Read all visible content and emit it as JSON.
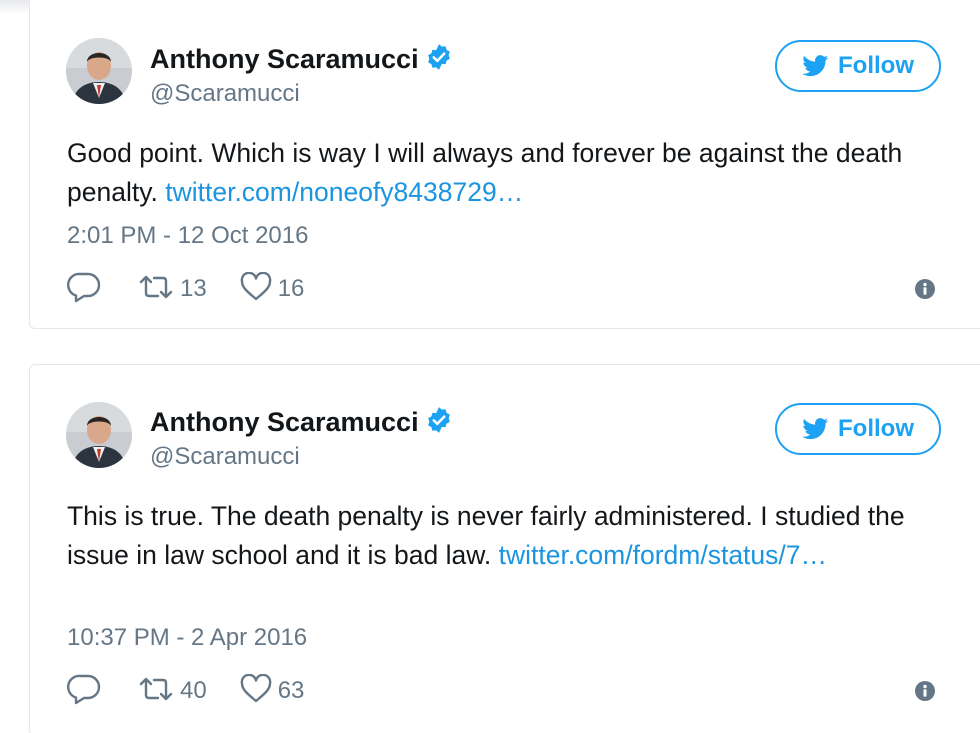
{
  "tweets": [
    {
      "author_name": "Anthony Scaramucci",
      "handle": "@Scaramucci",
      "follow_label": "Follow",
      "text": "Good point. Which is way I will always and forever be against the death penalty.",
      "link": "twitter.com/noneofy8438729…",
      "timestamp": "2:01 PM - 12 Oct 2016",
      "retweets": "13",
      "likes": "16"
    },
    {
      "author_name": "Anthony Scaramucci",
      "handle": "@Scaramucci",
      "follow_label": "Follow",
      "text": "This is true. The death penalty is never fairly administered. I studied the issue in law school and it is bad law.",
      "link": "twitter.com/fordm/status/7…",
      "timestamp": "10:37 PM - 2 Apr 2016",
      "retweets": "40",
      "likes": "63"
    }
  ],
  "colors": {
    "brand": "#1da1f2",
    "link": "#1b95e0",
    "text": "#14171a",
    "muted": "#657786",
    "border": "#e1e8ed"
  },
  "icons": [
    "verified-badge-icon",
    "twitter-bird-icon",
    "reply-icon",
    "retweet-icon",
    "heart-icon",
    "info-icon"
  ]
}
